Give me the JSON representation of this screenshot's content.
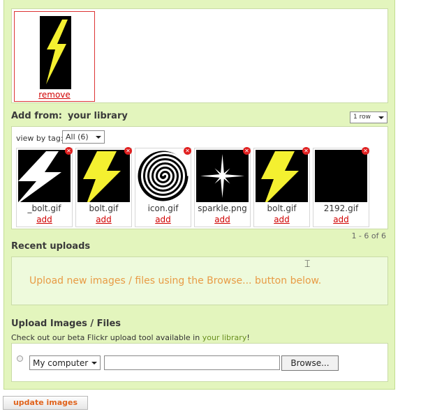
{
  "selected": {
    "remove_label": "remove"
  },
  "add_from": {
    "label": "Add from:",
    "source": "your library",
    "rows_select": "1 row"
  },
  "library": {
    "view_by_tag_label": "view by tag:",
    "tag_select": "All (6)",
    "items": [
      {
        "filename": "_bolt.gif",
        "add": "add",
        "thumb": "bolt-white"
      },
      {
        "filename": "bolt.gif",
        "add": "add",
        "thumb": "bolt-yellow"
      },
      {
        "filename": "icon.gif",
        "add": "add",
        "thumb": "spiral"
      },
      {
        "filename": "sparkle.png",
        "add": "add",
        "thumb": "sparkle"
      },
      {
        "filename": "bolt.gif",
        "add": "add",
        "thumb": "bolt-yellow"
      },
      {
        "filename": "2192.gif",
        "add": "add",
        "thumb": "black"
      }
    ],
    "pager": "1 - 6 of 6"
  },
  "recent": {
    "title": "Recent uploads",
    "message": "Upload new images / files using the Browse... button below."
  },
  "upload": {
    "title": "Upload Images / Files",
    "sub_prefix": "Check out our beta Flickr upload tool available in ",
    "sub_link": "your library",
    "sub_suffix": "!",
    "source_select": "My computer",
    "browse_label": "Browse..."
  },
  "update_button": "update images",
  "colors": {
    "panel_bg": "#e3f5bd",
    "link_red": "#d00000",
    "accent_orange": "#e0631c",
    "message_orange": "#e89b45",
    "bolt_yellow": "#f4f030"
  }
}
